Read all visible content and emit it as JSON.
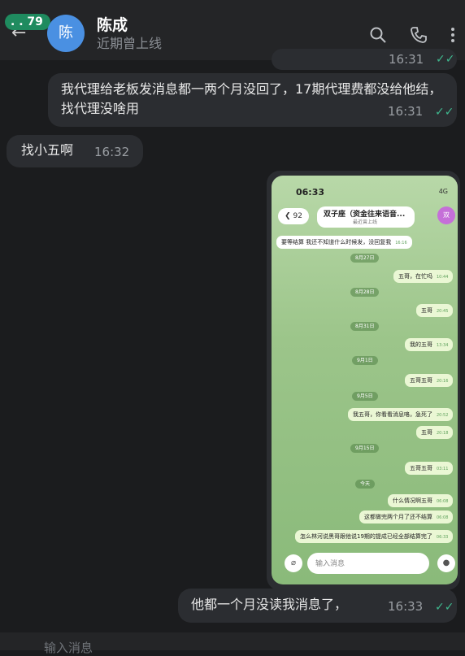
{
  "header": {
    "back_badge": ". . 79",
    "avatar_text": "陈",
    "name": "陈成",
    "status": "近期曾上线"
  },
  "messages": [
    {
      "text": "我代理给老板发消息都一两个月没回了，17期代理费都没给他结，找代理没啥用",
      "time": "16:31"
    },
    {
      "text": "找小五啊",
      "time": "16:32"
    },
    {
      "text": "他都一个月没读我消息了，",
      "time": "16:33"
    }
  ],
  "top_partial": {
    "time": "16:31"
  },
  "phone": {
    "status_time": "06:33",
    "status_net": "4G",
    "back_count": "92",
    "title": "双子座（资金往来语音...",
    "subtitle": "最近曾上线",
    "avatar_text": "双",
    "input_placeholder": "输入消息",
    "chat": [
      {
        "kind": "in",
        "text": "要等结算 我还不知道什么时候发，没回复我",
        "time": "16:16"
      },
      {
        "kind": "date",
        "text": "8月27日"
      },
      {
        "kind": "out",
        "text": "五哥，在忙吗",
        "time": "10:44"
      },
      {
        "kind": "date",
        "text": "8月28日"
      },
      {
        "kind": "out",
        "text": "五哥",
        "time": "20:45"
      },
      {
        "kind": "date",
        "text": "8月31日"
      },
      {
        "kind": "out",
        "text": "我的五哥",
        "time": "13:34"
      },
      {
        "kind": "date",
        "text": "9月1日"
      },
      {
        "kind": "out",
        "text": "五哥五哥",
        "time": "20:16"
      },
      {
        "kind": "date",
        "text": "9月5日"
      },
      {
        "kind": "out",
        "text": "我五哥，你看看消息咯，急死了",
        "time": "20:52"
      },
      {
        "kind": "out",
        "text": "五哥",
        "time": "20:18"
      },
      {
        "kind": "date",
        "text": "9月15日"
      },
      {
        "kind": "out",
        "text": "五哥五哥",
        "time": "03:11"
      },
      {
        "kind": "date",
        "text": "今天"
      },
      {
        "kind": "out",
        "text": "什么情况啊五哥",
        "time": "06:08"
      },
      {
        "kind": "out",
        "text": "这都做完两个月了还不结算",
        "time": "06:08"
      },
      {
        "kind": "out",
        "text": "怎么林河说黑哥跟他说19期的提成已经全部结算完了",
        "time": "06:33"
      }
    ]
  },
  "bottom": {
    "placeholder": "输入消息"
  }
}
